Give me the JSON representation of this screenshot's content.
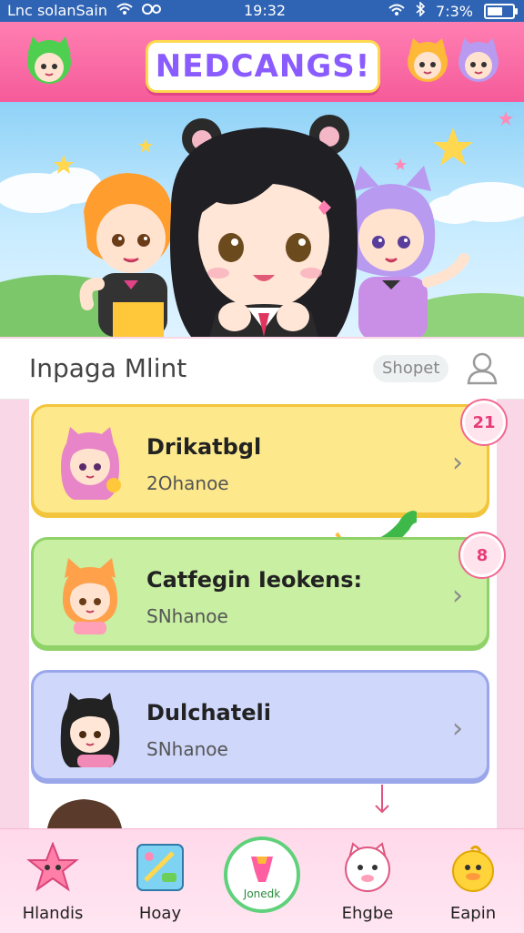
{
  "status_bar": {
    "carrier": "Lnc solanSain",
    "time": "19:32",
    "battery": "7:3%",
    "battery_level": 0.73
  },
  "header": {
    "title": "NEDCANGS!"
  },
  "section": {
    "title": "Inpaga Mlint",
    "shop_label": "Shopet"
  },
  "cards": [
    {
      "title": "Drikatbgl",
      "subtitle": "2Ohanoe",
      "badge": "21",
      "bg": "#fde98b",
      "border": "#f2c53c"
    },
    {
      "title": "Catfegin Ieokens:",
      "subtitle": "SNhanoe",
      "badge": "8",
      "bg": "#c8efa2",
      "border": "#8fd268"
    },
    {
      "title": "Dulchateli",
      "subtitle": "SNhanoe",
      "bg": "#cfd7fb",
      "border": "#9aa6ea"
    }
  ],
  "bottom_nav": {
    "items": [
      {
        "label": "Hlandis",
        "icon": "star-bear-icon"
      },
      {
        "label": "Hoay",
        "icon": "game-board-icon"
      },
      {
        "label": "Jonedk",
        "icon": "center-gem-icon"
      },
      {
        "label": "Ehgbe",
        "icon": "cat-face-icon"
      },
      {
        "label": "Eapin",
        "icon": "duck-icon"
      }
    ]
  },
  "colors": {
    "header_pink": "#f55b9a",
    "status_blue": "#2f63b3",
    "accent_green": "#5fd17a"
  }
}
